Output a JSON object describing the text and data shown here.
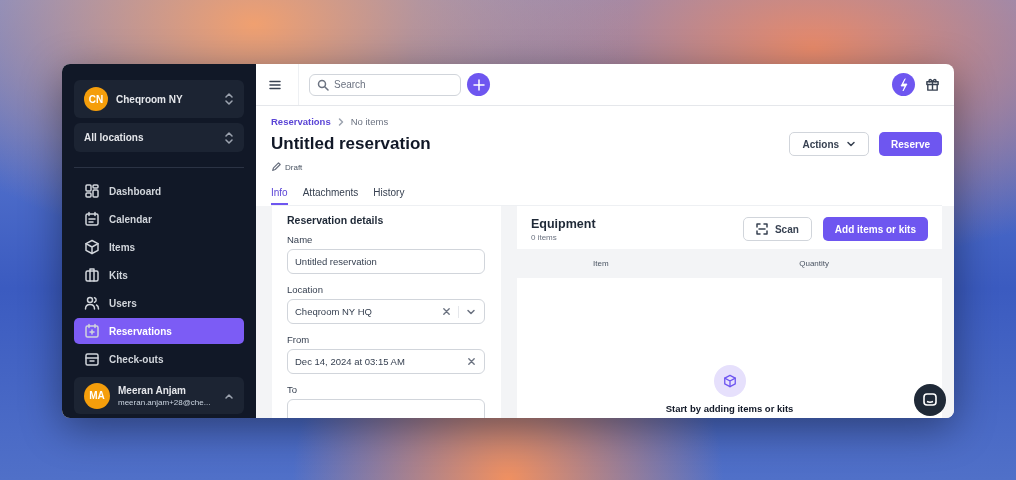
{
  "workspace": {
    "initials": "CN",
    "name": "Cheqroom NY"
  },
  "location_filter": {
    "label": "All locations"
  },
  "nav": [
    {
      "label": "Dashboard",
      "kind": "dashboard",
      "selected": false
    },
    {
      "label": "Calendar",
      "kind": "calendar",
      "selected": false
    },
    {
      "label": "Items",
      "kind": "items",
      "selected": false
    },
    {
      "label": "Kits",
      "kind": "kits",
      "selected": false
    },
    {
      "label": "Users",
      "kind": "users",
      "selected": false
    },
    {
      "label": "Reservations",
      "kind": "reservations",
      "selected": true
    },
    {
      "label": "Check-outs",
      "kind": "checkouts",
      "selected": false
    }
  ],
  "user": {
    "initials": "MA",
    "name": "Meeran Anjam",
    "email": "meeran.anjam+28@che..."
  },
  "topbar": {
    "search_placeholder": "Search"
  },
  "breadcrumb": [
    "Reservations",
    "No items"
  ],
  "title": "Untitled reservation",
  "status": "Draft",
  "buttons": {
    "actions": "Actions",
    "primary": "Reserve"
  },
  "tabs": [
    {
      "label": "Info",
      "selected": true
    },
    {
      "label": "Attachments",
      "selected": false
    },
    {
      "label": "History",
      "selected": false
    }
  ],
  "details": {
    "heading": "Reservation details",
    "fields": [
      {
        "label": "Name",
        "kind": "text",
        "value": "Untitled reservation"
      },
      {
        "label": "Location",
        "kind": "select",
        "value": "Cheqroom NY HQ"
      },
      {
        "label": "From",
        "kind": "date",
        "value": "Dec 14, 2024 at 03:15 AM"
      },
      {
        "label": "To",
        "kind": "date"
      }
    ]
  },
  "equipment": {
    "heading": "Equipment",
    "count": "0 items",
    "scan": "Scan",
    "add": "Add items or kits",
    "columns": [
      "Item",
      "Quantity"
    ],
    "empty_message": "Start by adding items or kits"
  }
}
